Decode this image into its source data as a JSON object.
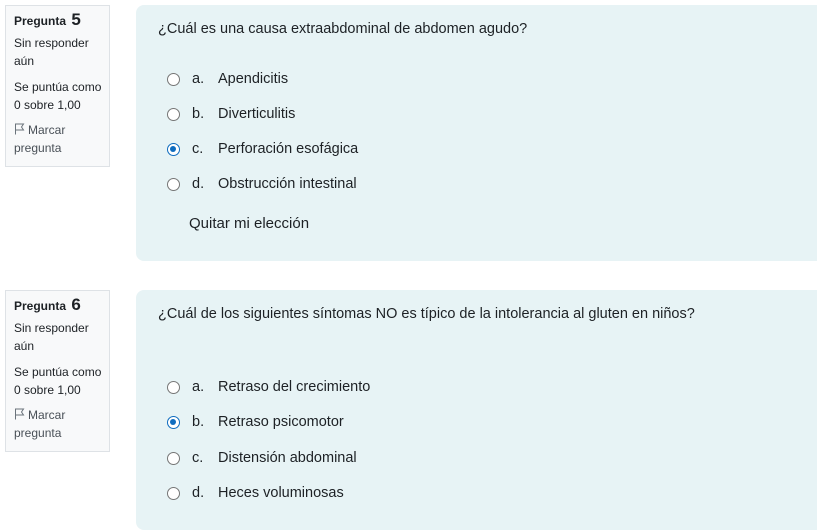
{
  "questions": [
    {
      "label": "Pregunta",
      "number": "5",
      "state": "Sin responder aún",
      "grade": "Se puntúa como 0 sobre 1,00",
      "flag_label": "Marcar pregunta",
      "text": "¿Cuál es una causa extraabdominal de abdomen agudo?",
      "options": [
        {
          "letter": "a.",
          "label": "Apendicitis",
          "checked": false
        },
        {
          "letter": "b.",
          "label": "Diverticulitis",
          "checked": false
        },
        {
          "letter": "c.",
          "label": "Perforación esofágica",
          "checked": true
        },
        {
          "letter": "d.",
          "label": "Obstrucción intestinal",
          "checked": false
        }
      ],
      "clear_label": "Quitar mi elección"
    },
    {
      "label": "Pregunta",
      "number": "6",
      "state": "Sin responder aún",
      "grade": "Se puntúa como 0 sobre 1,00",
      "flag_label": "Marcar pregunta",
      "text": "¿Cuál de los siguientes síntomas NO es típico de la intolerancia al gluten en niños?",
      "options": [
        {
          "letter": "a.",
          "label": "Retraso del crecimiento",
          "checked": false
        },
        {
          "letter": "b.",
          "label": "Retraso psicomotor",
          "checked": true
        },
        {
          "letter": "c.",
          "label": "Distensión abdominal",
          "checked": false
        },
        {
          "letter": "d.",
          "label": "Heces voluminosas",
          "checked": false
        }
      ]
    }
  ],
  "colors": {
    "accent": "#0f6cbf",
    "content_bg": "#e7f3f5",
    "info_bg": "#f8f9fa"
  }
}
